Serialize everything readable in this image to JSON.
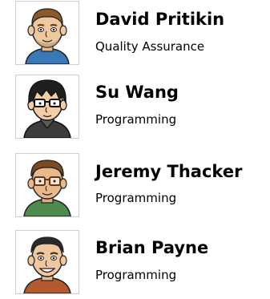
{
  "team": [
    {
      "name": "David Pritikin",
      "role": "Quality Assurance",
      "avatar_icon": "cartoon-man-stubble-avatar-icon",
      "colors": {
        "skin": "#f0c8a0",
        "hair": "#8a5a2b",
        "shirt": "#3a78b8"
      }
    },
    {
      "name": "Su Wang",
      "role": "Programming",
      "avatar_icon": "cartoon-man-glasses-dark-hair-avatar-icon",
      "colors": {
        "skin": "#f2cda6",
        "hair": "#1e1e1e",
        "shirt": "#3c3c3c"
      }
    },
    {
      "name": "Jeremy Thacker",
      "role": "Programming",
      "avatar_icon": "cartoon-man-glasses-avatar-icon",
      "colors": {
        "skin": "#e9b98a",
        "hair": "#7a4a22",
        "shirt": "#4f8a4f"
      }
    },
    {
      "name": "Brian Payne",
      "role": "Programming",
      "avatar_icon": "cartoon-man-smiling-avatar-icon",
      "colors": {
        "skin": "#f0c8a0",
        "hair": "#2a2a2a",
        "shirt": "#b35a2e"
      }
    }
  ]
}
